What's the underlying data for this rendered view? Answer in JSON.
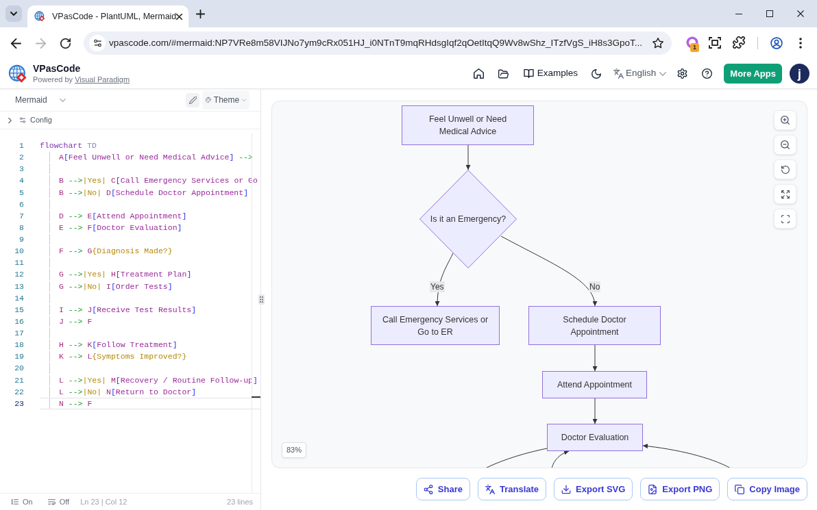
{
  "browser": {
    "tab": {
      "title": "VPasCode - PlantUML, Mermaid"
    },
    "back": {
      "disabled": false
    },
    "forward": {
      "disabled": true
    },
    "address": "vpascode.com/#mermaid:NP7VRe8m58VIJNo7ym9cRx051HJ_i0NTnT9mqRHdsgIqf2qOetItqQ9Wv8wShz_ITzfVgS_iH8s3GpoT...",
    "extension_badge": "1"
  },
  "header": {
    "app_name": "VPasCode",
    "tagline": "Powered by",
    "tagline_link": "Visual Paradigm",
    "examples": "Examples",
    "language": "English",
    "more_apps": "More Apps",
    "avatar": "j"
  },
  "editor": {
    "language": "Mermaid",
    "theme": "Theme",
    "config": {
      "label": "Config",
      "expanded": false
    },
    "lines": [
      {
        "number": "1",
        "active": false,
        "tokens": [
          {
            "kind": "keyword",
            "text": "flowchart"
          },
          {
            "kind": "direction",
            "text": " TD"
          }
        ],
        "children": [
          {
            "number": "2",
            "active": false,
            "tokens": [
              {
                "kind": "id",
                "text": "A"
              },
              {
                "kind": "bracket",
                "text": "["
              },
              {
                "kind": "text",
                "text": "Feel Unwell or Need Medical Advice"
              },
              {
                "kind": "bracket",
                "text": "]"
              },
              {
                "kind": "arrow",
                "text": " -->"
              }
            ]
          },
          {
            "number": "3",
            "active": false
          },
          {
            "number": "4",
            "active": false,
            "tokens": [
              {
                "kind": "id",
                "text": "B"
              },
              {
                "kind": "arrow",
                "text": " -->"
              },
              {
                "kind": "label",
                "text": "|Yes|"
              },
              {
                "kind": "id",
                "text": " C"
              },
              {
                "kind": "bracket",
                "text": "["
              },
              {
                "kind": "text",
                "text": "Call Emergency Services or Go"
              }
            ]
          },
          {
            "number": "5",
            "active": false,
            "tokens": [
              {
                "kind": "id",
                "text": "B"
              },
              {
                "kind": "arrow",
                "text": " -->"
              },
              {
                "kind": "label",
                "text": "|No|"
              },
              {
                "kind": "id",
                "text": " D"
              },
              {
                "kind": "bracket",
                "text": "["
              },
              {
                "kind": "text",
                "text": "Schedule Doctor Appointment"
              },
              {
                "kind": "bracket",
                "text": "]"
              }
            ]
          },
          {
            "number": "6",
            "active": false
          },
          {
            "number": "7",
            "active": false,
            "tokens": [
              {
                "kind": "id",
                "text": "D"
              },
              {
                "kind": "arrow",
                "text": " -->"
              },
              {
                "kind": "id",
                "text": " E"
              },
              {
                "kind": "bracket",
                "text": "["
              },
              {
                "kind": "text",
                "text": "Attend Appointment"
              },
              {
                "kind": "bracket",
                "text": "]"
              }
            ]
          },
          {
            "number": "8",
            "active": false,
            "tokens": [
              {
                "kind": "id",
                "text": "E"
              },
              {
                "kind": "arrow",
                "text": " -->"
              },
              {
                "kind": "id",
                "text": " F"
              },
              {
                "kind": "bracket",
                "text": "["
              },
              {
                "kind": "text",
                "text": "Doctor Evaluation"
              },
              {
                "kind": "bracket",
                "text": "]"
              }
            ]
          },
          {
            "number": "9",
            "active": false
          },
          {
            "number": "10",
            "active": false,
            "tokens": [
              {
                "kind": "id",
                "text": "F"
              },
              {
                "kind": "arrow",
                "text": " -->"
              },
              {
                "kind": "id",
                "text": " G"
              },
              {
                "kind": "decision",
                "text": "{Diagnosis Made?}"
              }
            ]
          },
          {
            "number": "11",
            "active": false
          },
          {
            "number": "12",
            "active": false,
            "tokens": [
              {
                "kind": "id",
                "text": "G"
              },
              {
                "kind": "arrow",
                "text": " -->"
              },
              {
                "kind": "label",
                "text": "|Yes|"
              },
              {
                "kind": "id",
                "text": " H"
              },
              {
                "kind": "bracket",
                "text": "["
              },
              {
                "kind": "text",
                "text": "Treatment Plan"
              },
              {
                "kind": "bracket",
                "text": "]"
              }
            ]
          },
          {
            "number": "13",
            "active": false,
            "tokens": [
              {
                "kind": "id",
                "text": "G"
              },
              {
                "kind": "arrow",
                "text": " -->"
              },
              {
                "kind": "label",
                "text": "|No|"
              },
              {
                "kind": "id",
                "text": " I"
              },
              {
                "kind": "bracket",
                "text": "["
              },
              {
                "kind": "text",
                "text": "Order Tests"
              },
              {
                "kind": "bracket",
                "text": "]"
              }
            ]
          },
          {
            "number": "14",
            "active": false
          },
          {
            "number": "15",
            "active": false,
            "tokens": [
              {
                "kind": "id",
                "text": "I"
              },
              {
                "kind": "arrow",
                "text": " -->"
              },
              {
                "kind": "id",
                "text": " J"
              },
              {
                "kind": "bracket",
                "text": "["
              },
              {
                "kind": "text",
                "text": "Receive Test Results"
              },
              {
                "kind": "bracket",
                "text": "]"
              }
            ]
          },
          {
            "number": "16",
            "active": false,
            "tokens": [
              {
                "kind": "id",
                "text": "J"
              },
              {
                "kind": "arrow",
                "text": " -->"
              },
              {
                "kind": "id",
                "text": " F"
              }
            ]
          },
          {
            "number": "17",
            "active": false
          },
          {
            "number": "18",
            "active": false,
            "tokens": [
              {
                "kind": "id",
                "text": "H"
              },
              {
                "kind": "arrow",
                "text": " -->"
              },
              {
                "kind": "id",
                "text": " K"
              },
              {
                "kind": "bracket",
                "text": "["
              },
              {
                "kind": "text",
                "text": "Follow Treatment"
              },
              {
                "kind": "bracket",
                "text": "]"
              }
            ]
          },
          {
            "number": "19",
            "active": false,
            "tokens": [
              {
                "kind": "id",
                "text": "K"
              },
              {
                "kind": "arrow",
                "text": " -->"
              },
              {
                "kind": "id",
                "text": " L"
              },
              {
                "kind": "decision",
                "text": "{Symptoms Improved?}"
              }
            ]
          },
          {
            "number": "20",
            "active": false
          },
          {
            "number": "21",
            "active": false,
            "tokens": [
              {
                "kind": "id",
                "text": "L"
              },
              {
                "kind": "arrow",
                "text": " -->"
              },
              {
                "kind": "label",
                "text": "|Yes|"
              },
              {
                "kind": "id",
                "text": " M"
              },
              {
                "kind": "bracket",
                "text": "["
              },
              {
                "kind": "text",
                "text": "Recovery / Routine Follow-up"
              },
              {
                "kind": "bracket",
                "text": "]"
              }
            ]
          },
          {
            "number": "22",
            "active": false,
            "tokens": [
              {
                "kind": "id",
                "text": "L"
              },
              {
                "kind": "arrow",
                "text": " -->"
              },
              {
                "kind": "label",
                "text": "|No|"
              },
              {
                "kind": "id",
                "text": " N"
              },
              {
                "kind": "bracket",
                "text": "["
              },
              {
                "kind": "text",
                "text": "Return to Doctor"
              },
              {
                "kind": "bracket",
                "text": "]"
              }
            ]
          },
          {
            "number": "23",
            "active": true,
            "tokens": [
              {
                "kind": "id",
                "text": "N"
              },
              {
                "kind": "arrow",
                "text": " -->"
              },
              {
                "kind": "id",
                "text": " F"
              }
            ]
          }
        ]
      }
    ],
    "status_bar": {
      "toggles": [
        {
          "kind": "line-numbers",
          "label": "On"
        },
        {
          "kind": "word-wrap",
          "label": "Off"
        }
      ],
      "cursor": "Ln 23 | Col 12",
      "line_count": "23 lines"
    }
  },
  "diagram": {
    "nodes": [
      {
        "kind": "process",
        "lines": [
          "Feel Unwell or Need",
          "Medical Advice"
        ]
      },
      {
        "kind": "decision",
        "lines": [
          "Is it an Emergency?"
        ]
      },
      {
        "kind": "process",
        "lines": [
          "Call Emergency Services or",
          "Go to ER"
        ]
      },
      {
        "kind": "process",
        "lines": [
          "Schedule Doctor",
          "Appointment"
        ]
      },
      {
        "kind": "process",
        "lines": [
          "Attend Appointment"
        ]
      },
      {
        "kind": "process",
        "lines": [
          "Doctor Evaluation"
        ]
      }
    ],
    "edge_labels": [
      {
        "text": "Yes"
      },
      {
        "text": "No"
      }
    ],
    "zoom": "83%"
  },
  "actions": [
    {
      "kind": "share",
      "label": "Share"
    },
    {
      "kind": "translate",
      "label": "Translate"
    },
    {
      "kind": "export-svg",
      "label": "Export SVG"
    },
    {
      "kind": "export-png",
      "label": "Export PNG"
    },
    {
      "kind": "copy-image",
      "label": "Copy Image"
    }
  ]
}
